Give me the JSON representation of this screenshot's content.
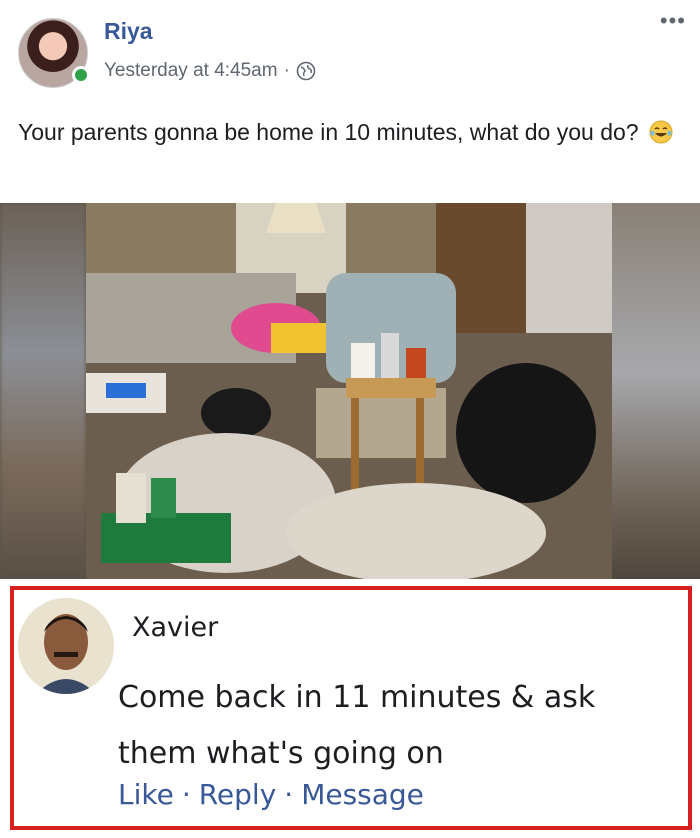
{
  "post": {
    "author": "Riya",
    "timestamp": "Yesterday at 4:45am",
    "meta_separator": "·",
    "privacy_icon": "globe-icon",
    "more_label": "•••",
    "text": "Your parents gonna be home in 10 minutes, what do you do?",
    "emoji": "laughing-tears-emoji"
  },
  "comment": {
    "author": "Xavier",
    "text": "Come back in 11 minutes & ask them what's going on",
    "actions": {
      "like": "Like",
      "reply": "Reply",
      "message": "Message",
      "separator": "·"
    }
  },
  "colors": {
    "link_blue": "#385898",
    "online_green": "#31a24c",
    "highlight_red": "#d42020",
    "meta_gray": "#606770"
  }
}
